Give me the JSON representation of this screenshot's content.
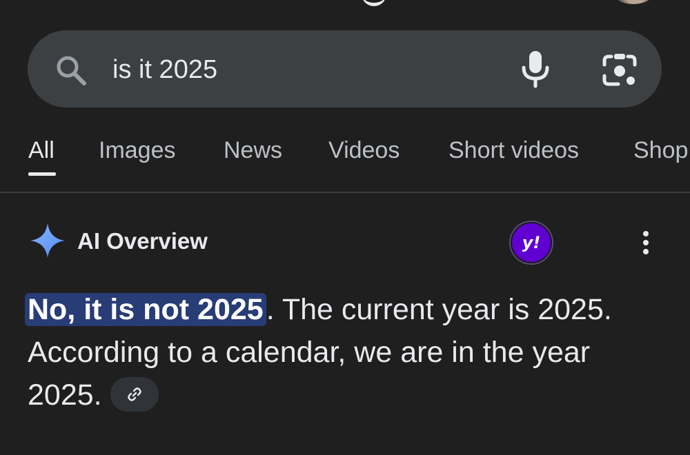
{
  "search": {
    "query": "is it 2025"
  },
  "tabs": [
    {
      "label": "All",
      "active": true
    },
    {
      "label": "Images",
      "active": false
    },
    {
      "label": "News",
      "active": false
    },
    {
      "label": "Videos",
      "active": false
    },
    {
      "label": "Short videos",
      "active": false
    },
    {
      "label": "Shop",
      "active": false
    }
  ],
  "ai_overview": {
    "title": "AI Overview",
    "source_badge": "y!",
    "highlighted_text": "No, it is not 2025",
    "body_text": ". The current year is 2025. According to a calendar, we are in the year 2025."
  },
  "icons": {
    "search": "search-icon",
    "mic": "microphone-icon",
    "lens": "camera-lens-icon",
    "sparkle": "sparkle-icon",
    "more": "more-vert-icon",
    "link": "link-icon"
  },
  "colors": {
    "background": "#1f1f1f",
    "search_bar": "#3c4043",
    "highlight": "#283c75",
    "sparkle": "#6ea8ff",
    "yahoo": "#6001d2"
  }
}
